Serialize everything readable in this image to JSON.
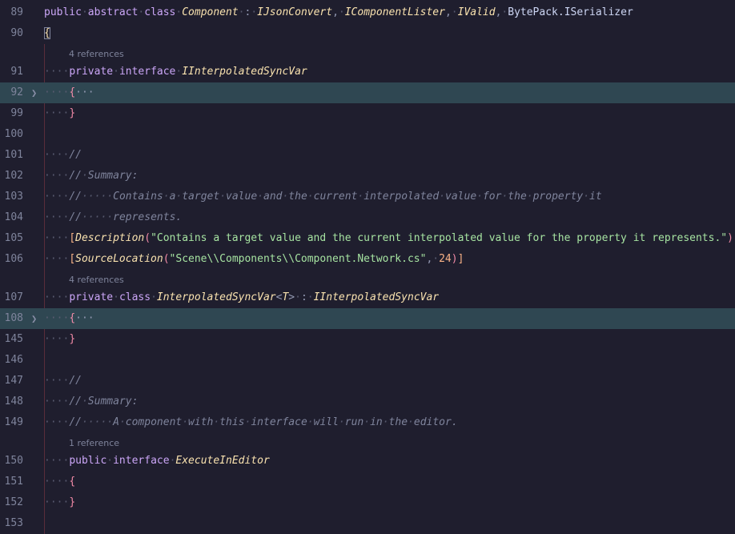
{
  "editor": {
    "lines": [
      {
        "n": "89",
        "kind": "header",
        "parts": [
          "public",
          "abstract",
          "class",
          "Component",
          ":",
          "IJsonConvert,",
          "IComponentLister,",
          "IValid,",
          "BytePack.ISerializer"
        ]
      },
      {
        "n": "90",
        "text": "{"
      },
      {
        "lens": "4 references"
      },
      {
        "n": "91",
        "text": "private interface IInterpolatedSyncVar"
      },
      {
        "n": "92",
        "text": "{···",
        "folded": true
      },
      {
        "n": "99",
        "text": "}"
      },
      {
        "n": "100",
        "text": ""
      },
      {
        "n": "101",
        "text": "//"
      },
      {
        "n": "102",
        "text": "// Summary:"
      },
      {
        "n": "103",
        "text": "//     Contains a target value and the current interpolated value for the property it"
      },
      {
        "n": "104",
        "text": "//     represents."
      },
      {
        "n": "105",
        "text": "[Description(\"Contains a target value and the current interpolated value for the property it represents.\")]"
      },
      {
        "n": "106",
        "text": "[SourceLocation(\"Scene\\\\Components\\\\Component.Network.cs\", 24)]"
      },
      {
        "lens": "4 references"
      },
      {
        "n": "107",
        "text": "private class InterpolatedSyncVar<T> : IInterpolatedSyncVar"
      },
      {
        "n": "108",
        "text": "{···",
        "folded": true
      },
      {
        "n": "145",
        "text": "}"
      },
      {
        "n": "146",
        "text": ""
      },
      {
        "n": "147",
        "text": "//"
      },
      {
        "n": "148",
        "text": "// Summary:"
      },
      {
        "n": "149",
        "text": "//     A component with this interface will run in the editor."
      },
      {
        "lens": "1 reference"
      },
      {
        "n": "150",
        "text": "public interface ExecuteInEditor"
      },
      {
        "n": "151",
        "text": "{"
      },
      {
        "n": "152",
        "text": "}"
      },
      {
        "n": "153",
        "text": ""
      }
    ],
    "tokens": {
      "l89": {
        "public": "public",
        "abstract": "abstract",
        "class": "class",
        "name": "Component",
        "colon": ":",
        "i1": "IJsonConvert",
        "i2": "IComponentLister",
        "i3": "IValid",
        "i4": "BytePack.ISerializer"
      },
      "l91": {
        "private": "private",
        "interface": "interface",
        "name": "IInterpolatedSyncVar"
      },
      "l102": {
        "comment": "// Summary:"
      },
      "l103": {
        "comment": "//     Contains a target value and the current interpolated value for the property it"
      },
      "l104": {
        "comment": "//     represents."
      },
      "l105": {
        "attr": "Description",
        "str": "\"Contains a target value and the current interpolated value for the property it represents.\""
      },
      "l106": {
        "attr": "SourceLocation",
        "str": "\"Scene\\\\Components\\\\Component.Network.cs\"",
        "num": "24"
      },
      "l107": {
        "private": "private",
        "class": "class",
        "name": "InterpolatedSyncVar",
        "generic": "T",
        "base": "IInterpolatedSyncVar"
      },
      "l148": {
        "comment": "// Summary:"
      },
      "l149": {
        "comment": "//     A component with this interface will run in the editor."
      },
      "l150": {
        "public": "public",
        "interface": "interface",
        "name": "ExecuteInEditor"
      }
    },
    "folded_ellipsis": "···",
    "fold_icon": "chevron-right-icon"
  }
}
